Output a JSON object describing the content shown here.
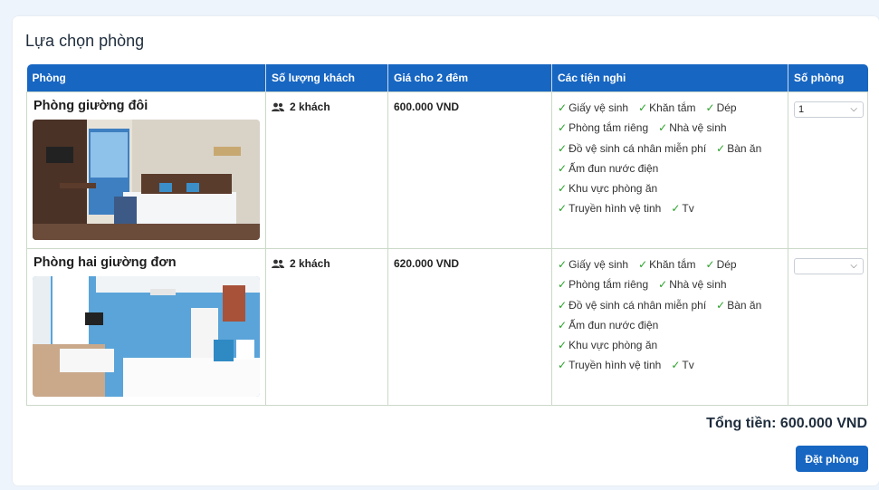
{
  "section": {
    "title": "Lựa chọn phòng"
  },
  "table": {
    "headers": [
      "Phòng",
      "Số lượng khách",
      "Giá cho 2 đêm",
      "Các tiện nghi",
      "Số phòng"
    ]
  },
  "rooms": [
    {
      "name": "Phòng giường đôi",
      "guests": "2 khách",
      "price": "600.000 VND",
      "amenities": [
        [
          "Giấy vệ sinh",
          "Khăn tắm",
          "Dép"
        ],
        [
          "Phòng tắm riêng",
          "Nhà vệ sinh"
        ],
        [
          "Đồ vệ sinh cá nhân miễn phí",
          "Bàn ăn"
        ],
        [
          "Ấm đun nước điện"
        ],
        [
          "Khu vực phòng ăn"
        ],
        [
          "Truyền hình vệ tinh",
          "Tv"
        ]
      ],
      "rooms_selected": "1"
    },
    {
      "name": "Phòng hai giường đơn",
      "guests": "2 khách",
      "price": "620.000 VND",
      "amenities": [
        [
          "Giấy vệ sinh",
          "Khăn tắm",
          "Dép"
        ],
        [
          "Phòng tắm riêng",
          "Nhà vệ sinh"
        ],
        [
          "Đồ vệ sinh cá nhân miễn phí",
          "Bàn ăn"
        ],
        [
          "Ấm đun nước điện"
        ],
        [
          "Khu vực phòng ăn"
        ],
        [
          "Truyền hình vệ tinh",
          "Tv"
        ]
      ],
      "rooms_selected": ""
    }
  ],
  "summary": {
    "total": "Tổng tiền: 600.000 VND"
  },
  "actions": {
    "book_label": "Đặt phòng"
  },
  "icons": {
    "guests": "users-icon",
    "check": "check-icon",
    "dropdown": "chevron-down-icon"
  },
  "colors": {
    "primary": "#1766c2",
    "check": "#2aa12a"
  }
}
